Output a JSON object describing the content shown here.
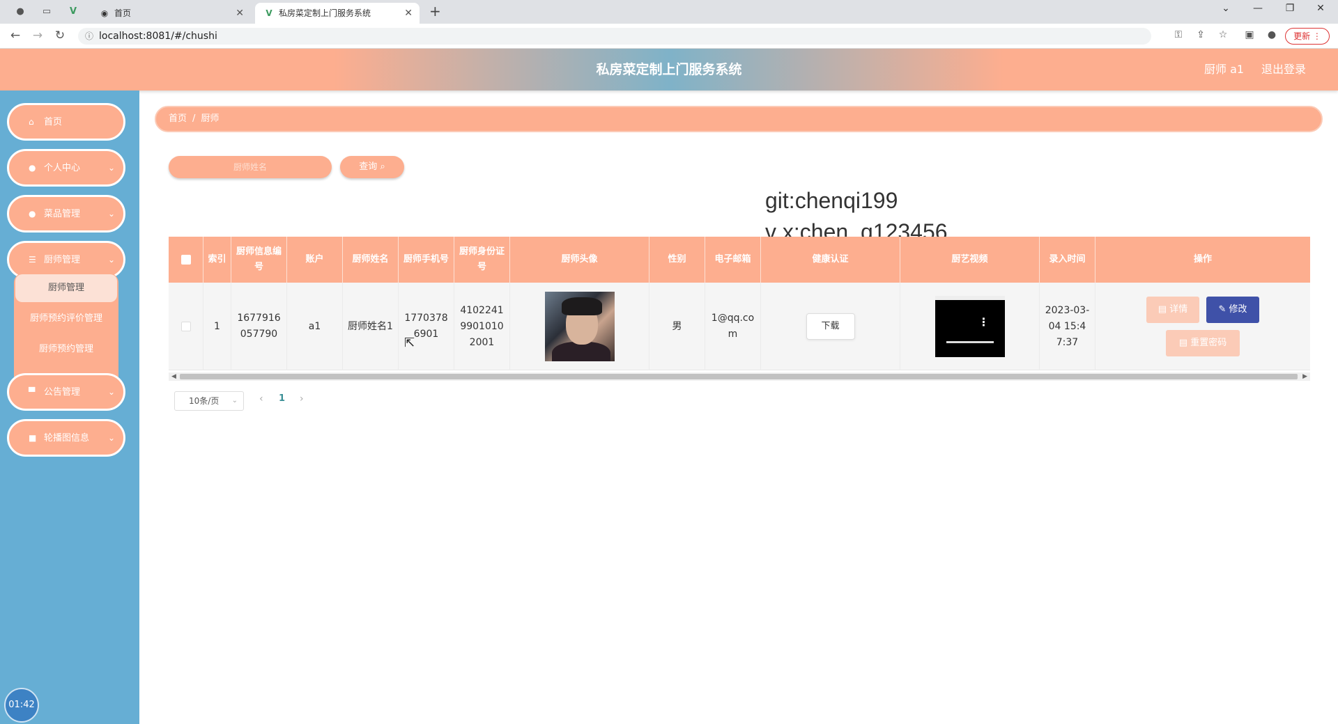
{
  "browser": {
    "inactive_tab_title": "首页",
    "active_tab_title": "私房菜定制上门服务系统",
    "url": "localhost:8081/#/chushi",
    "update_label": "更新"
  },
  "header": {
    "title": "私房菜定制上门服务系统",
    "user": "厨师 a1",
    "logout": "退出登录"
  },
  "sidebar": {
    "items": [
      {
        "label": "首页"
      },
      {
        "label": "个人中心"
      },
      {
        "label": "菜品管理"
      },
      {
        "label": "厨师管理"
      },
      {
        "label": "公告管理"
      },
      {
        "label": "轮播图信息"
      }
    ],
    "submenu": [
      {
        "label": "厨师管理"
      },
      {
        "label": "厨师预约评价管理"
      },
      {
        "label": "厨师预约管理"
      }
    ],
    "timer": "01:42"
  },
  "breadcrumb": {
    "home": "首页",
    "separator": "/",
    "current": "厨师"
  },
  "search": {
    "placeholder": "厨师姓名",
    "button_label": "查询"
  },
  "watermark": {
    "line1": "git:chenqi199",
    "line2": "v x:chen_q123456"
  },
  "table": {
    "columns": [
      "索引",
      "厨师信息编号",
      "账户",
      "厨师姓名",
      "厨师手机号",
      "厨师身份证号",
      "厨师头像",
      "性别",
      "电子邮箱",
      "健康认证",
      "厨艺视频",
      "录入时间",
      "操作"
    ],
    "rows": [
      {
        "index": "1",
        "chef_no": "1677916057790",
        "account": "a1",
        "name": "厨师姓名1",
        "phone": "17703786901",
        "id_card": "410224199010102001",
        "gender": "男",
        "email": "1@qq.com",
        "health_btn": "下载",
        "created": "2023-03-04 15:47:37",
        "btn_detail": "详情",
        "btn_edit": "修改",
        "btn_reset": "重置密码"
      }
    ]
  },
  "pagination": {
    "page_size": "10条/页",
    "current_page": "1"
  },
  "colors": {
    "accent": "#fdae8f",
    "sidebar_bg": "#66aed4",
    "edit_btn": "#3f51a8"
  }
}
